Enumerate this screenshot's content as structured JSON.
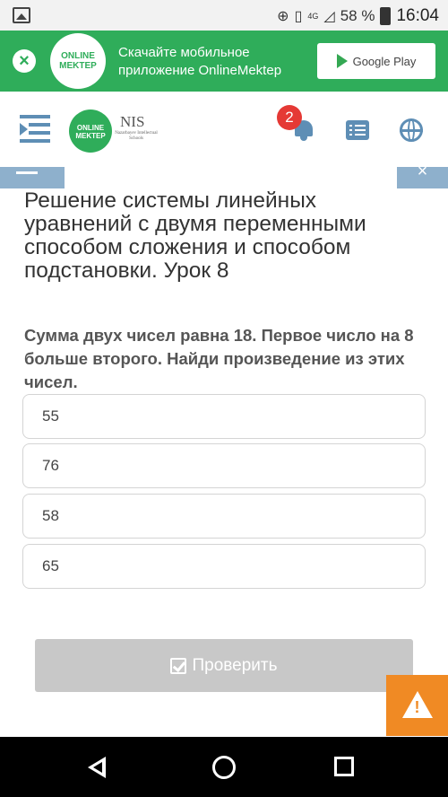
{
  "status_bar": {
    "network": "4G",
    "battery": "58 %",
    "time": "16:04"
  },
  "banner": {
    "logo_text": "ONLINE MEKTEP",
    "message_line1": "Скачайте мобильное",
    "message_line2": "приложение OnlineMektep",
    "store_button": "Google Play"
  },
  "header": {
    "logo_text": "ONLINE MEKTEP",
    "partner_logo": "NIS",
    "partner_sub": "Nazarbayev Intellectual Schools",
    "notification_count": "2"
  },
  "lesson": {
    "title": "Решение системы линейных уравнений с двумя переменными способом сложения и способом подстановки. Урок 8"
  },
  "question": {
    "text": "Сумма двух чисел равна 18. Первое число на 8 больше второго. Найди произведение из этих чисел.",
    "options": [
      "55",
      "76",
      "58",
      "65"
    ]
  },
  "actions": {
    "check_label": "Проверить"
  },
  "colors": {
    "brand_green": "#2fad5a",
    "accent_blue": "#5e8eb5",
    "warning_orange": "#f08a24",
    "badge_red": "#e53935"
  }
}
